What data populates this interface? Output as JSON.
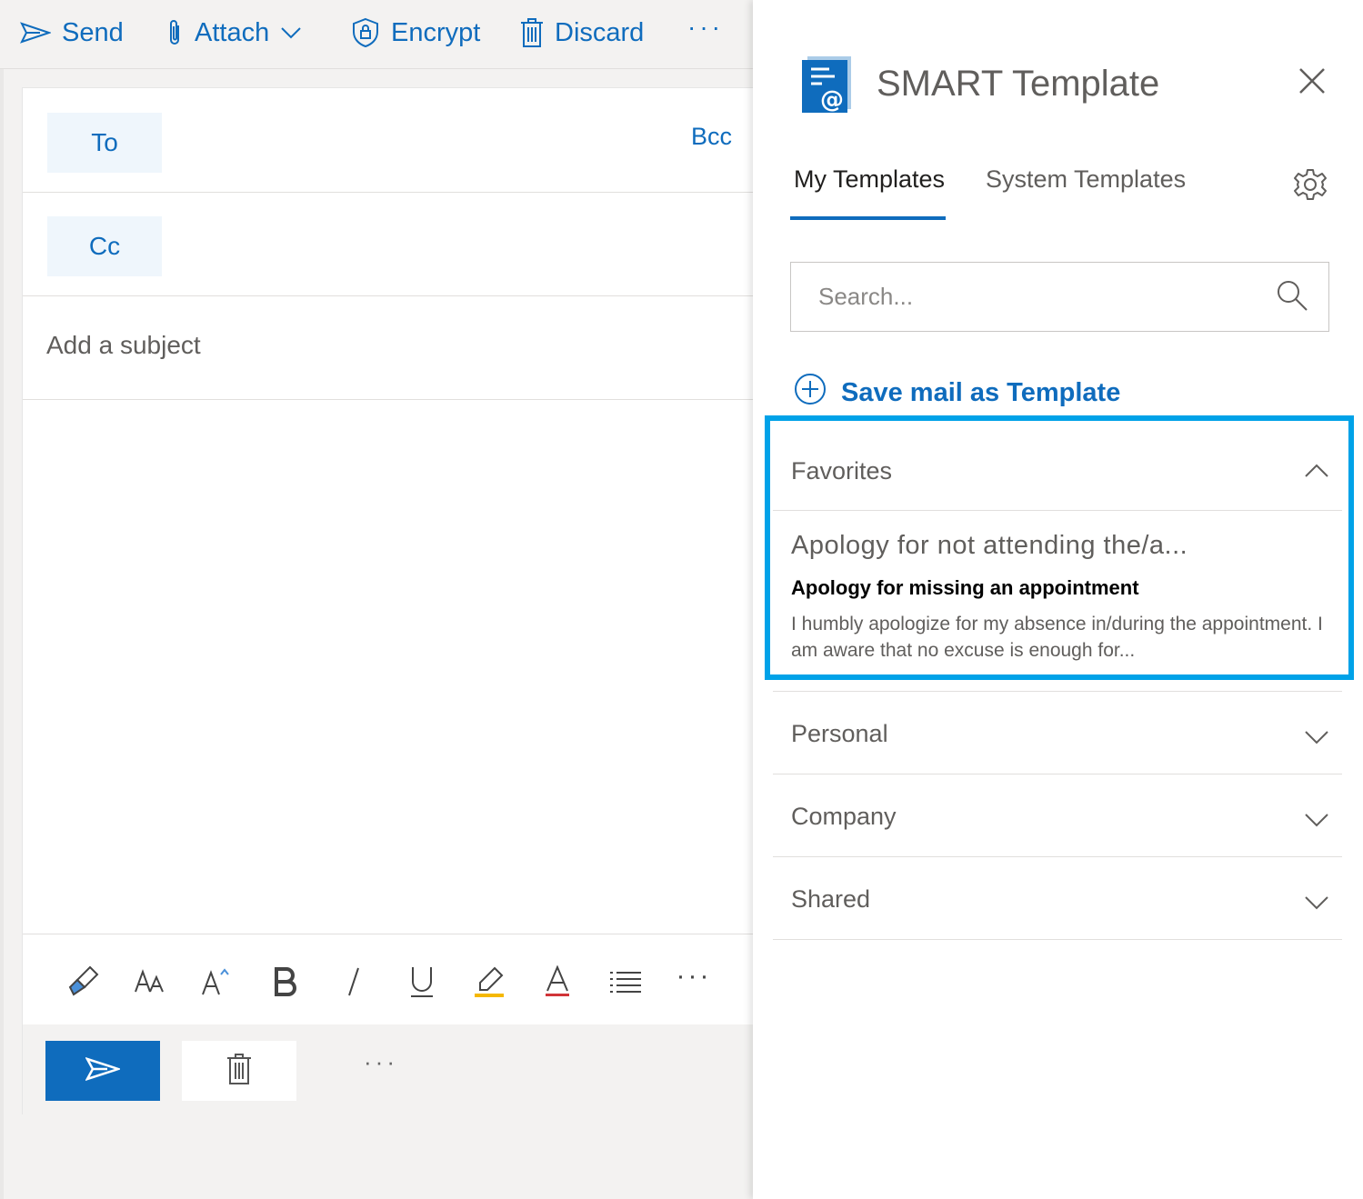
{
  "toolbar": {
    "send_label": "Send",
    "attach_label": "Attach",
    "encrypt_label": "Encrypt",
    "discard_label": "Discard",
    "more_label": "···"
  },
  "compose": {
    "to_label": "To",
    "bcc_label": "Bcc",
    "cc_label": "Cc",
    "subject_placeholder": "Add a subject",
    "more_label": "···",
    "format_more_label": "···"
  },
  "pane": {
    "title": "SMART Template",
    "tabs": [
      {
        "label": "My Templates",
        "active": true
      },
      {
        "label": "System Templates",
        "active": false
      }
    ],
    "search_placeholder": "Search...",
    "save_label": "Save mail as Template",
    "sections": [
      {
        "label": "Favorites",
        "expanded": true,
        "templates": [
          {
            "name": "Apology for not attending the/a...",
            "subject": "Apology for missing an appointment",
            "preview": "I humbly apologize for my absence in/during the appointment. I am aware that no excuse is enough for..."
          }
        ]
      },
      {
        "label": "Personal",
        "expanded": false
      },
      {
        "label": "Company",
        "expanded": false
      },
      {
        "label": "Shared",
        "expanded": false
      }
    ]
  },
  "colors": {
    "accent": "#0f6cbd",
    "highlight_border": "#00a2e8",
    "chip_bg": "#eff6fc"
  }
}
